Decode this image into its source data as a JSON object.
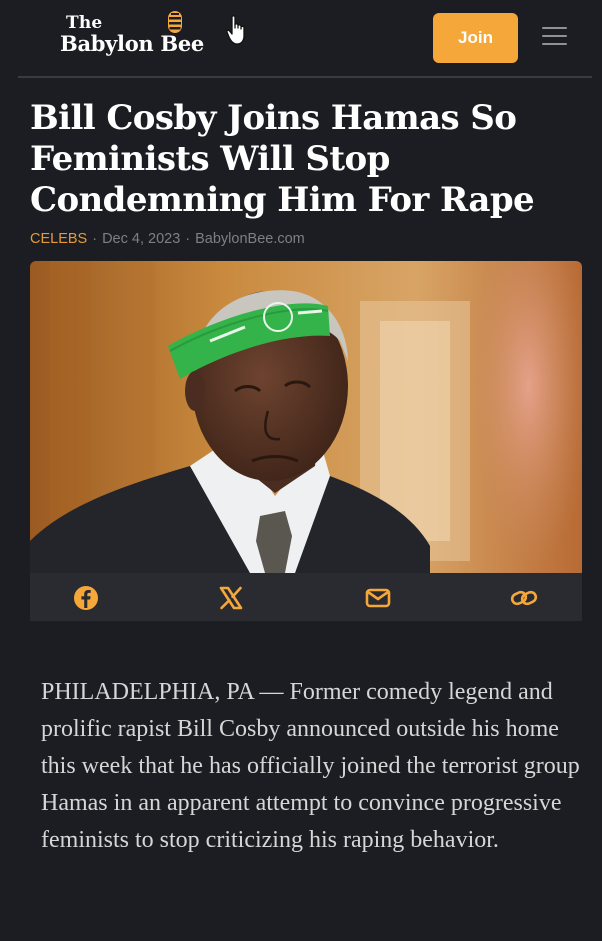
{
  "header": {
    "logo_line1": "The",
    "logo_line2": "Babylon Bee",
    "logo_icon": "bee-icon",
    "join_label": "Join",
    "menu_icon": "hamburger-menu-icon",
    "accent_color": "#f6a73a"
  },
  "article": {
    "headline": "Bill Cosby Joins Hamas So Feminists Will Stop Condemning Him For Rape",
    "category": "CELEBS",
    "date": "Dec 4, 2023",
    "source": "BabylonBee.com",
    "separator": "·",
    "image_icon": "article-photo",
    "body": "PHILADELPHIA, PA — Former comedy legend and prolific rapist Bill Cosby announced outside his home this week that he has officially joined the terrorist group Hamas in an apparent attempt to convince progressive feminists to stop criticizing his raping behavior."
  },
  "share": {
    "icons": [
      "facebook-icon",
      "x-icon",
      "email-icon",
      "link-icon"
    ],
    "color": "#f6a73a"
  }
}
